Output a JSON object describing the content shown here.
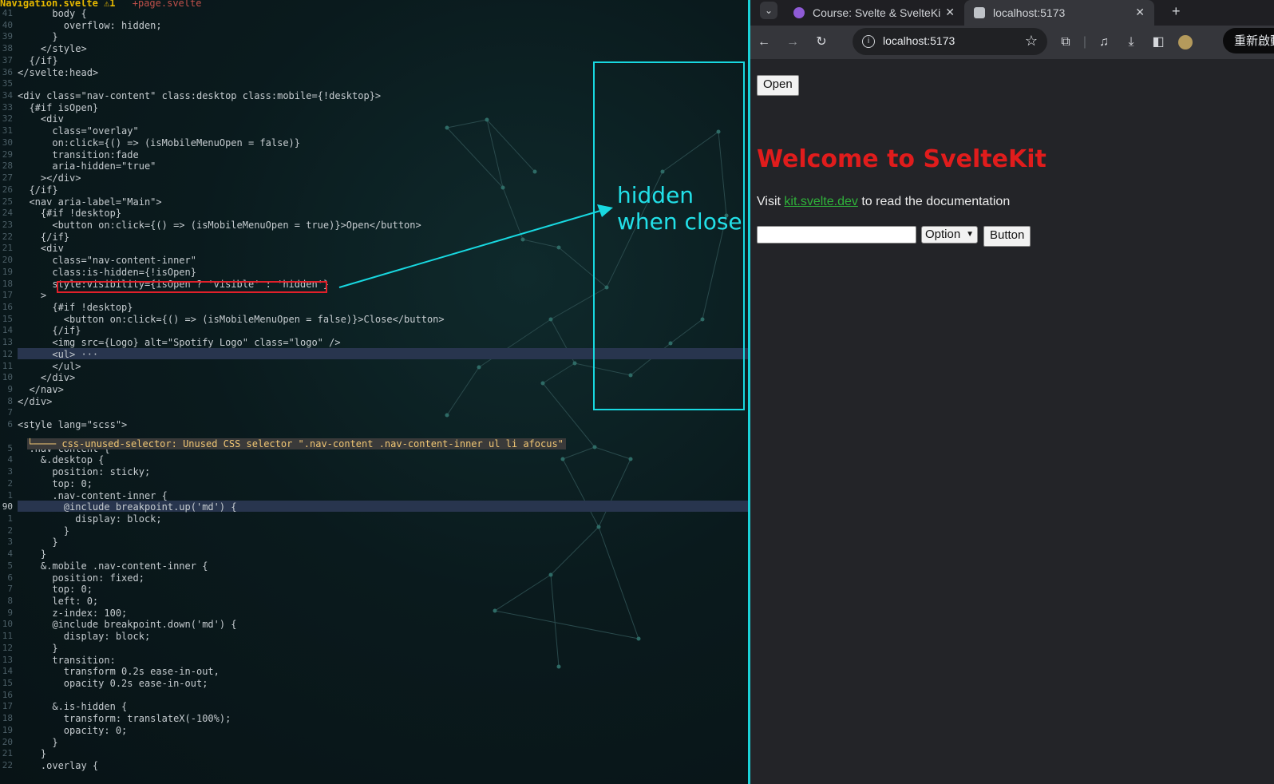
{
  "editor": {
    "tabs": {
      "active": "Navigation.svelte",
      "active_badge": "⚠1",
      "other": "+page.svelte"
    },
    "gutter": [
      "41",
      "40",
      "39",
      "38",
      "37",
      "36",
      "35",
      "34",
      "33",
      "32",
      "31",
      "30",
      "29",
      "28",
      "27",
      "26",
      "25",
      "24",
      "23",
      "22",
      "21",
      "20",
      "19",
      "18",
      "17",
      "16",
      "15",
      "14",
      "13",
      "12",
      "11",
      "10",
      "9",
      "8",
      "7",
      "6",
      "5",
      "4",
      "3",
      "2",
      "1",
      "90",
      "1",
      "2",
      "3",
      "4",
      "5",
      "6",
      "7",
      "8",
      "9",
      "10",
      "11",
      "12",
      "13",
      "14",
      "15",
      "16",
      "17",
      "18",
      "19",
      "20",
      "21",
      "22"
    ],
    "lines": [
      "      body {",
      "        overflow: hidden;",
      "      }",
      "    </style>",
      "  {/if}",
      "</svelte:head>",
      "",
      "<div class=\"nav-content\" class:desktop class:mobile={!desktop}>",
      "  {#if isOpen}",
      "    <div",
      "      class=\"overlay\"",
      "      on:click={() => (isMobileMenuOpen = false)}",
      "      transition:fade",
      "      aria-hidden=\"true\"",
      "    ></div>",
      "  {/if}",
      "  <nav aria-label=\"Main\">",
      "    {#if !desktop}",
      "      <button on:click={() => (isMobileMenuOpen = true)}>Open</button>",
      "    {/if}",
      "    <div",
      "      class=\"nav-content-inner\"",
      "      class:is-hidden={!isOpen}",
      "      style:visibility={isOpen ? 'visible' : 'hidden'}",
      "    >",
      "      {#if !desktop}",
      "        <button on:click={() => (isMobileMenuOpen = false)}>Close</button>",
      "      {/if}",
      "      <img src={Logo} alt=\"Spotify Logo\" class=\"logo\" />",
      "      <ul> ···",
      "      </ul>",
      "    </div>",
      "  </nav>",
      "</div>",
      "",
      "<style lang=\"scss\">",
      "  .nav-content {",
      "    &.desktop {",
      "      position: sticky;",
      "      top: 0;",
      "      .nav-content-inner {",
      "        @include breakpoint.up('md') {",
      "          display: block;",
      "        }",
      "      }",
      "    }",
      "    &.mobile .nav-content-inner {",
      "      position: fixed;",
      "      top: 0;",
      "      left: 0;",
      "      z-index: 100;",
      "      @include breakpoint.down('md') {",
      "        display: block;",
      "      }",
      "      transition:",
      "        transform 0.2s ease-in-out,",
      "        opacity 0.2s ease-in-out;",
      "",
      "      &.is-hidden {",
      "        transform: translateX(-100%);",
      "        opacity: 0;",
      "      }",
      "    }",
      "    .overlay {"
    ],
    "diagnostic": "└──── css-unused-selector: Unused CSS selector \".nav-content .nav-content-inner ul li afocus\"",
    "annotation": [
      "hidden",
      "when close"
    ],
    "colors": {
      "highlight_box": "#e0202a",
      "annotation": "#18d8e0"
    }
  },
  "browser": {
    "tabs": [
      {
        "title": "Course: Svelte & SvelteKi",
        "icon": "course-favicon-icon"
      },
      {
        "title": "localhost:5173",
        "icon": "svelte-favicon-icon"
      }
    ],
    "new_tab": "+",
    "url": "localhost:5173",
    "restart_label": "重新啟動",
    "page": {
      "open_button": "Open",
      "title": "Welcome to SvelteKit",
      "text_before": "Visit ",
      "link": "kit.svelte.dev",
      "text_after": " to read the documentation",
      "input_value": "",
      "select_value": "Option",
      "button": "Button"
    },
    "colors": {
      "title": "#e01c1c",
      "link": "#2fb23a"
    }
  }
}
